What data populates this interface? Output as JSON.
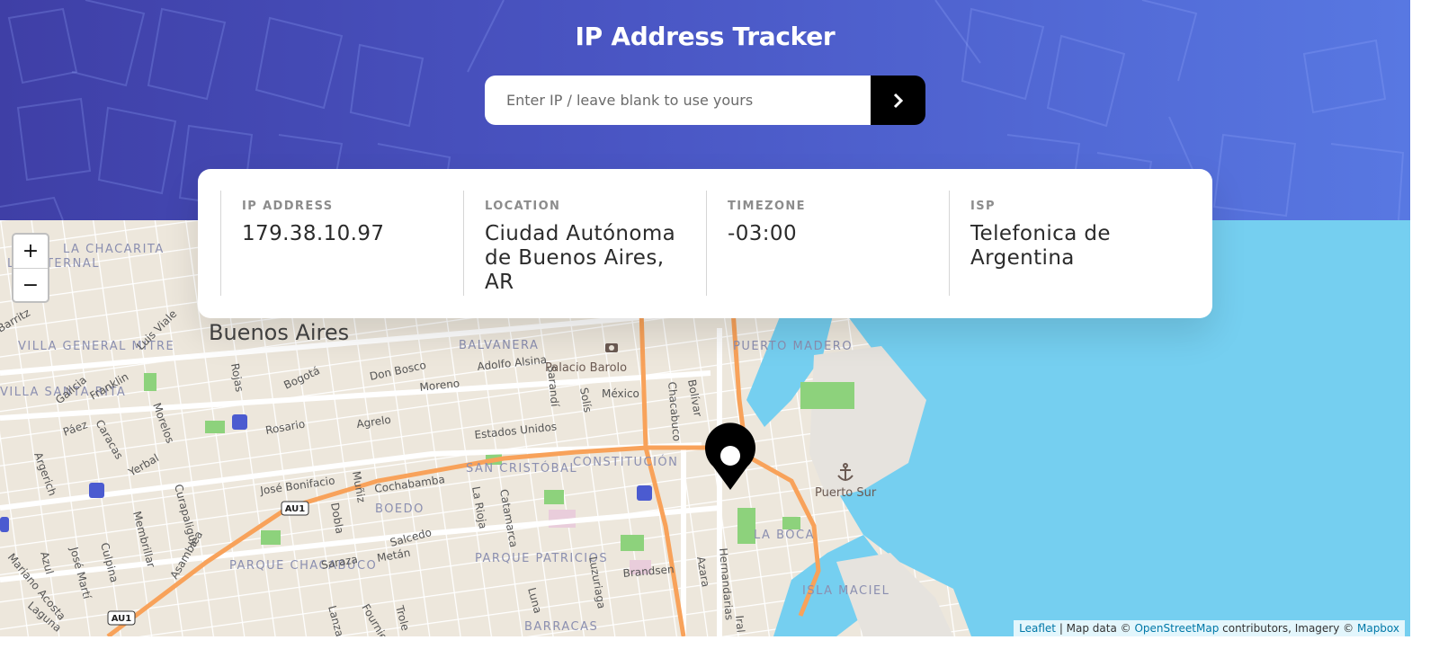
{
  "header": {
    "title": "IP Address Tracker",
    "search_placeholder": "Enter IP / leave blank to use yours"
  },
  "info": [
    {
      "label": "IP ADDRESS",
      "value": "179.38.10.97"
    },
    {
      "label": "LOCATION",
      "value": "Ciudad Autónoma de Buenos Aires, AR"
    },
    {
      "label": "TIMEZONE",
      "value": "-03:00"
    },
    {
      "label": "ISP",
      "value": "Telefonica de Argentina"
    }
  ],
  "map": {
    "zoom_in": "+",
    "zoom_out": "−",
    "city_label": "Buenos Aires",
    "neighborhoods": [
      "LA CHACARITA",
      "LA PATERNAL",
      "VILLA GENERAL MITRE",
      "BALVANERA",
      "PUERTO MADERO",
      "SAN CRISTÓBAL",
      "CONSTITUCIÓN",
      "BOEDO",
      "PARQUE CHACABUCO",
      "PARQUE PATRICIOS",
      "LA BOCA",
      "ISLA MACIEL",
      "BARRACAS",
      "VILLA SANTA RITA"
    ],
    "streets": [
      "Rosario",
      "Bogotá",
      "Don Bosco",
      "Adolfo Alsina",
      "Moreno",
      "México",
      "Agrelo",
      "Estados Unidos",
      "José Bonifacio",
      "Cochabamba",
      "Salcedo",
      "Metán",
      "Saraza",
      "Brandsen",
      "Rojas",
      "Luis Viale",
      "Franklin",
      "Galicia",
      "Páez",
      "Caracas",
      "Morelos",
      "Yerbal",
      "Curapaligüe",
      "Membrillar",
      "Culpina",
      "Azul",
      "José Martí",
      "Mariano Acosta",
      "Asamblea",
      "Laguna",
      "Lanza",
      "Fournier",
      "Trole",
      "Luna",
      "Luzuriaga",
      "Azara",
      "Hernandarias",
      "Catamarca",
      "La Rioja",
      "Dobla",
      "Muñiz",
      "Solís",
      "Sarandí",
      "Chacabuco",
      "Bolívar",
      "Barritz",
      "Argerich",
      "Iral"
    ],
    "places": [
      "Palacio Barolo",
      "Puerto Sur"
    ],
    "route_badges": [
      "AU1",
      "AU1"
    ],
    "colors": {
      "water": "#75cff0",
      "land": "#ede7dc",
      "park": "#8dd27c",
      "highway": "#f8a25a",
      "marker": "#000000"
    },
    "marker_icon": "map-pin-icon",
    "attribution": {
      "leaflet": "Leaflet",
      "sep1": " | Map data © ",
      "osm": "OpenStreetMap",
      "sep2": " contributors, Imagery © ",
      "mapbox": "Mapbox"
    }
  }
}
